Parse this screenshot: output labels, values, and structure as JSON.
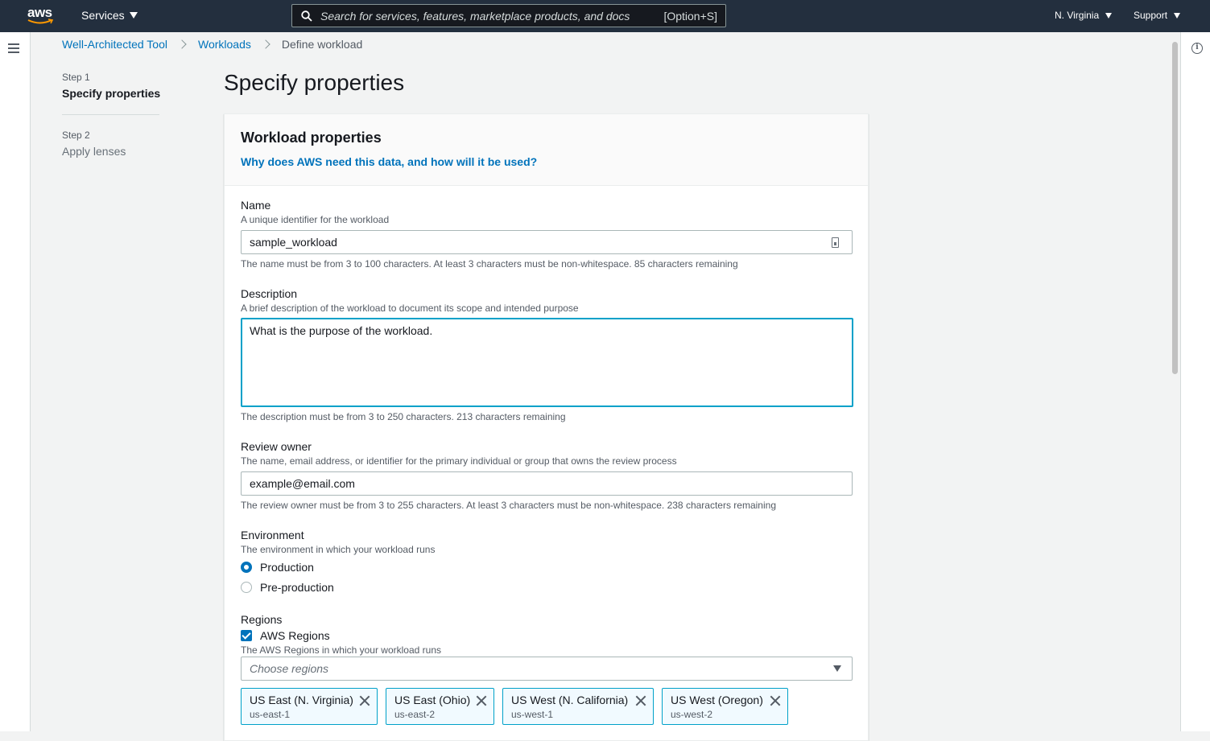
{
  "nav": {
    "logo_text": "aws",
    "services_label": "Services",
    "search_placeholder": "Search for services, features, marketplace products, and docs",
    "search_shortcut": "[Option+S]",
    "region_label": "N. Virginia",
    "support_label": "Support"
  },
  "breadcrumb": {
    "items": [
      "Well-Architected Tool",
      "Workloads",
      "Define workload"
    ]
  },
  "steps": [
    {
      "label": "Step 1",
      "title": "Specify properties"
    },
    {
      "label": "Step 2",
      "title": "Apply lenses"
    }
  ],
  "page_title": "Specify properties",
  "container": {
    "title": "Workload properties",
    "link": "Why does AWS need this data, and how will it be used?"
  },
  "fields": {
    "name": {
      "label": "Name",
      "description": "A unique identifier for the workload",
      "value": "sample_workload",
      "constraint": "The name must be from 3 to 100 characters. At least 3 characters must be non-whitespace. 85 characters remaining"
    },
    "description": {
      "label": "Description",
      "description": "A brief description of the workload to document its scope and intended purpose",
      "value": "What is the purpose of the workload.",
      "constraint": "The description must be from 3 to 250 characters. 213 characters remaining"
    },
    "review_owner": {
      "label": "Review owner",
      "description": "The name, email address, or identifier for the primary individual or group that owns the review process",
      "value": "example@email.com",
      "constraint": "The review owner must be from 3 to 255 characters. At least 3 characters must be non-whitespace. 238 characters remaining"
    },
    "environment": {
      "label": "Environment",
      "description": "The environment in which your workload runs",
      "options": [
        "Production",
        "Pre-production"
      ],
      "selected": "Production"
    },
    "regions": {
      "label": "Regions",
      "checkbox_label": "AWS Regions",
      "description": "The AWS Regions in which your workload runs",
      "placeholder": "Choose regions",
      "tokens": [
        {
          "label": "US East (N. Virginia)",
          "code": "us-east-1"
        },
        {
          "label": "US East (Ohio)",
          "code": "us-east-2"
        },
        {
          "label": "US West (N. California)",
          "code": "us-west-1"
        },
        {
          "label": "US West (Oregon)",
          "code": "us-west-2"
        }
      ]
    }
  },
  "colors": {
    "nav_bg": "#232f3e",
    "link": "#0073bb",
    "focus": "#00a1c9"
  }
}
